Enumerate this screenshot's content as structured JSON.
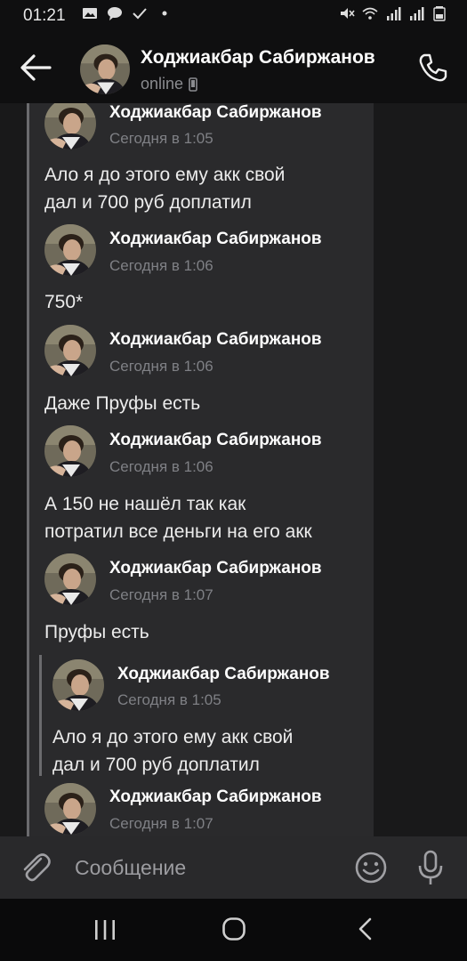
{
  "status_bar": {
    "time": "01:21"
  },
  "header": {
    "name": "Ходжиакбар Сабиржанов",
    "status": "online"
  },
  "messages": [
    {
      "sender": "Ходжиакбар Сабиржанов",
      "time": "Сегодня в 1:05",
      "lines": [
        "Ало я до этого ему акк свой",
        "дал и 700 руб доплатил"
      ]
    },
    {
      "sender": "Ходжиакбар Сабиржанов",
      "time": "Сегодня в 1:06",
      "lines": [
        "750*"
      ]
    },
    {
      "sender": "Ходжиакбар Сабиржанов",
      "time": "Сегодня в 1:06",
      "lines": [
        "Даже Пруфы есть"
      ]
    },
    {
      "sender": "Ходжиакбар Сабиржанов",
      "time": "Сегодня в 1:06",
      "lines": [
        "А 150 не нашёл так как",
        "потратил все деньги на его акк"
      ]
    },
    {
      "sender": "Ходжиакбар Сабиржанов",
      "time": "Сегодня в 1:07",
      "lines": [
        "Пруфы есть"
      ]
    },
    {
      "sender": "Ходжиакбар Сабиржанов",
      "time": "Сегодня в 1:07",
      "lines": []
    }
  ],
  "quoted": {
    "sender": "Ходжиакбар Сабиржанов",
    "time": "Сегодня в 1:05",
    "lines": [
      "Ало я до этого ему акк свой",
      "дал и 700 руб доплатил"
    ]
  },
  "composer": {
    "placeholder": "Сообщение"
  },
  "icons": {
    "back": "arrow-left-icon",
    "call": "phone-icon",
    "attach": "paperclip-icon",
    "emoji": "smiley-icon",
    "mic": "microphone-icon",
    "nav_recent": "recent-apps-icon",
    "nav_home": "home-icon",
    "nav_back": "nav-back-icon"
  }
}
